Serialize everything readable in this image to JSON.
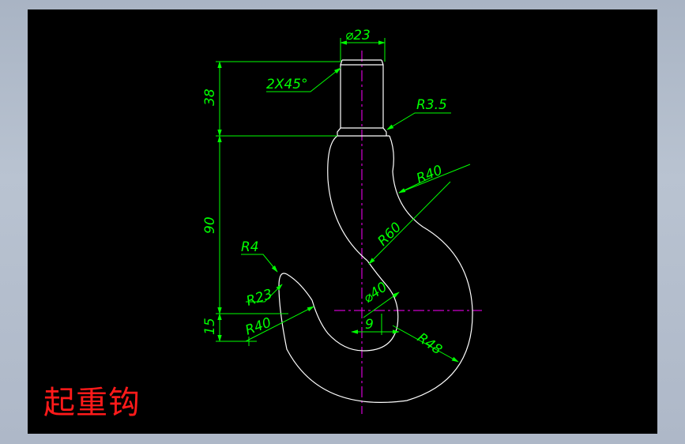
{
  "title": "起重钩",
  "dimensions": {
    "diameter_23": "⌀23",
    "chamfer": "2X45°",
    "height_38": "38",
    "radius_3_5": "R3.5",
    "radius_40_top": "R40",
    "height_90": "90",
    "radius_60": "R60",
    "radius_4": "R4",
    "radius_23": "R23",
    "diameter_40": "⌀40",
    "radius_40_bottom": "R40",
    "height_15": "15",
    "offset_9": "9",
    "radius_48": "R48"
  },
  "colors": {
    "background": "#000000",
    "outline": "#ffffff",
    "dimension": "#00ff00",
    "centerline": "#ff00ff",
    "title": "#ff1a1a"
  }
}
